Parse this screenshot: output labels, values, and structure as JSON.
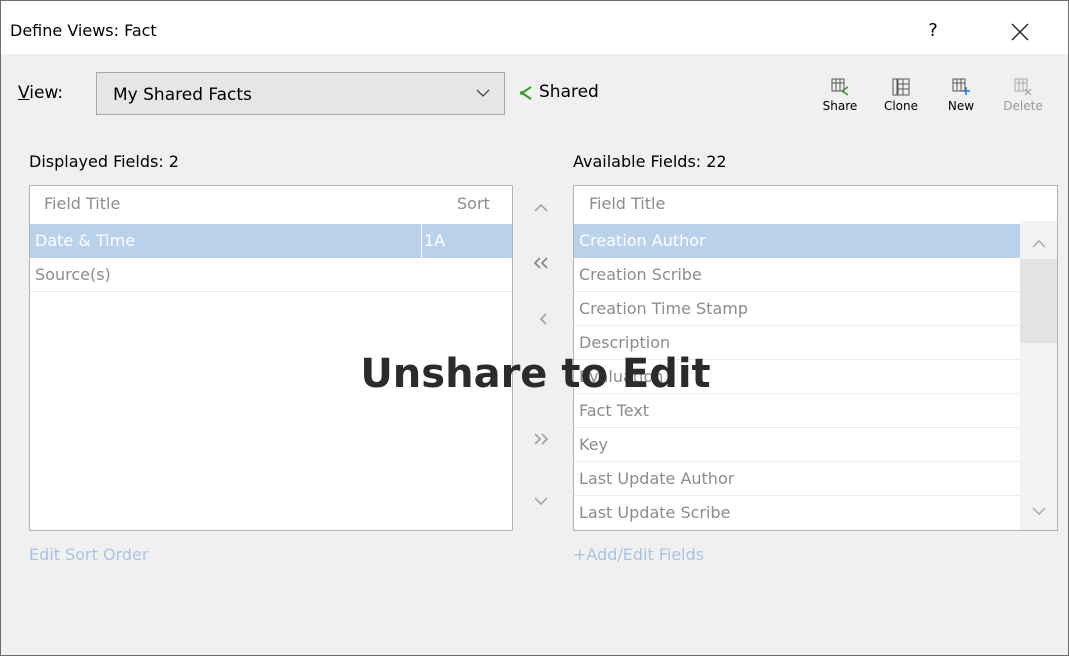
{
  "window": {
    "title": "Define Views: Fact",
    "help_label": "?"
  },
  "view": {
    "label_underlined": "V",
    "label_rest": "iew:",
    "selected": "My Shared Facts",
    "status": "Shared"
  },
  "toolbar": {
    "share": "Share",
    "clone": "Clone",
    "new": "New",
    "delete": "Delete"
  },
  "displayed": {
    "label": "Displayed Fields: 2",
    "columns": [
      "Field Title",
      "Sort"
    ],
    "rows": [
      {
        "title": "Date & Time",
        "sort": "1A",
        "selected": true
      },
      {
        "title": "Source(s)",
        "sort": "",
        "selected": false
      }
    ],
    "edit_sort_link": "Edit Sort Order"
  },
  "available": {
    "label": "Available Fields: 22",
    "columns": [
      "Field Title"
    ],
    "rows": [
      "Creation Author",
      "Creation Scribe",
      "Creation Time Stamp",
      "Description",
      "Evaluation",
      "Fact Text",
      "Key",
      "Last Update Author",
      "Last Update Scribe"
    ],
    "add_link": "+Add/Edit Fields"
  },
  "overlay": {
    "text": "Unshare to Edit"
  },
  "colors": {
    "selection": "#b9d1ea",
    "shared_green": "#3a9a2e",
    "link": "#a9c3e4"
  }
}
